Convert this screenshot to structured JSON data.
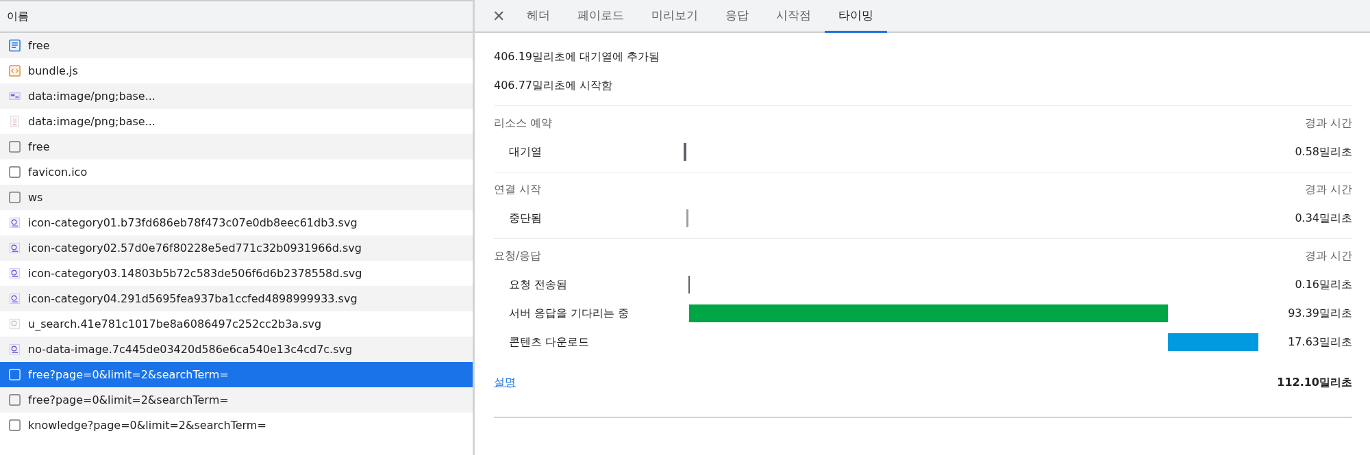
{
  "request_list": {
    "column_header": "이름",
    "rows": [
      {
        "name": "free",
        "kind": "document",
        "selected": false
      },
      {
        "name": "bundle.js",
        "kind": "script",
        "selected": false
      },
      {
        "name": "data:image/png;base...",
        "kind": "image-wide",
        "selected": false
      },
      {
        "name": "data:image/png;base...",
        "kind": "image-tall",
        "selected": false
      },
      {
        "name": "free",
        "kind": "other",
        "selected": false
      },
      {
        "name": "favicon.ico",
        "kind": "other",
        "selected": false
      },
      {
        "name": "ws",
        "kind": "other",
        "selected": false
      },
      {
        "name": "icon-category01.b73fd686eb78f473c07e0db8eec61db3.svg",
        "kind": "svg",
        "selected": false
      },
      {
        "name": "icon-category02.57d0e76f80228e5ed771c32b0931966d.svg",
        "kind": "svg",
        "selected": false
      },
      {
        "name": "icon-category03.14803b5b72c583de506f6d6b2378558d.svg",
        "kind": "svg",
        "selected": false
      },
      {
        "name": "icon-category04.291d5695fea937ba1ccfed4898999933.svg",
        "kind": "svg",
        "selected": false
      },
      {
        "name": "u_search.41e781c1017be8a6086497c252cc2b3a.svg",
        "kind": "svg-gray",
        "selected": false
      },
      {
        "name": "no-data-image.7c445de03420d586e6ca540e13c4cd7c.svg",
        "kind": "svg",
        "selected": false
      },
      {
        "name": "free?page=0&limit=2&searchTerm=",
        "kind": "other",
        "selected": true
      },
      {
        "name": "free?page=0&limit=2&searchTerm=",
        "kind": "other",
        "selected": false
      },
      {
        "name": "knowledge?page=0&limit=2&searchTerm=",
        "kind": "other",
        "selected": false
      }
    ]
  },
  "detail": {
    "close": "✕",
    "tabs": [
      {
        "label": "헤더",
        "selected": false
      },
      {
        "label": "페이로드",
        "selected": false
      },
      {
        "label": "미리보기",
        "selected": false
      },
      {
        "label": "응답",
        "selected": false
      },
      {
        "label": "시작점",
        "selected": false
      },
      {
        "label": "타이밍",
        "selected": true
      }
    ],
    "summary": [
      "406.19밀리초에 대기열에 추가됨",
      "406.77밀리초에 시작함"
    ],
    "sections": [
      {
        "title": "리소스 예약",
        "time_header": "경과 시간",
        "rows": [
          {
            "label": "대기열",
            "color": "#5f6368",
            "value": "0.58밀리초"
          }
        ]
      },
      {
        "title": "연결 시작",
        "time_header": "경과 시간",
        "rows": [
          {
            "label": "중단됨",
            "color": "#9aa0a6",
            "value": "0.34밀리초"
          }
        ]
      },
      {
        "title": "요청/응답",
        "time_header": "경과 시간",
        "rows": [
          {
            "label": "요청 전송됨",
            "color": "#5f6368",
            "value": "0.16밀리초"
          },
          {
            "label": "서버 응답을 기다리는 중",
            "color": "#00a645",
            "value": "93.39밀리초"
          },
          {
            "label": "콘텐츠 다운로드",
            "color": "#009ae0",
            "value": "17.63밀리초"
          }
        ]
      }
    ],
    "explanation_link": "설명",
    "total": "112.10밀리초"
  }
}
